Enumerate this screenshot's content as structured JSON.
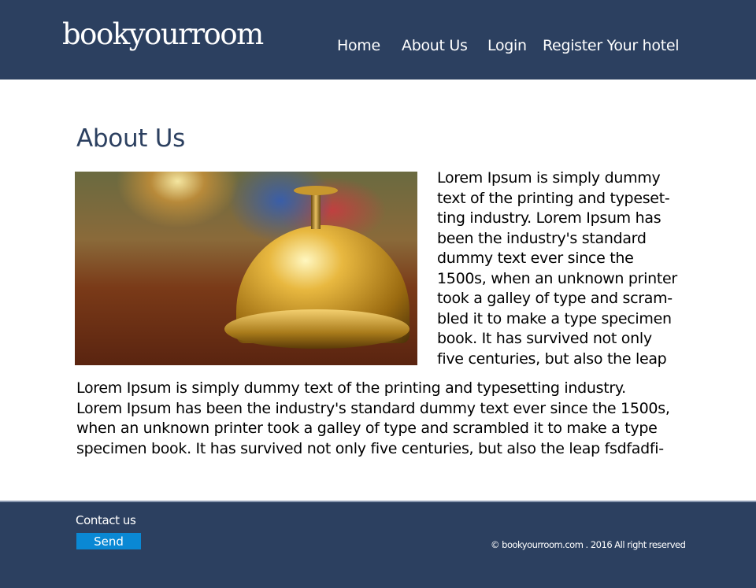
{
  "header": {
    "logo": "bookyourroom",
    "nav": [
      "Home",
      "About Us",
      "Login",
      "Register Your hotel"
    ]
  },
  "main": {
    "title": "About Us",
    "side_text_lines": [
      "Lorem Ipsum is simply dummy",
      "text of the printing and typeset-",
      "ting industry. Lorem Ipsum has",
      "been the industry's standard",
      "dummy text ever since the",
      "1500s, when an unknown printer",
      "took a galley of type and scram-",
      "bled it to make a type specimen",
      "book. It has survived not only",
      "five centuries, but also the leap"
    ],
    "body_text_lines": [
      "Lorem Ipsum is simply dummy text of the printing and typesetting industry.",
      "Lorem Ipsum has been the industry's standard dummy text ever since the 1500s,",
      "when an unknown printer took a galley of type and scrambled it to make a type",
      "specimen book. It has survived not only five centuries, but also the leap fsdfadfi-"
    ]
  },
  "footer": {
    "contact_label": "Contact us",
    "send_label": "Send",
    "copyright": "© bookyourroom.com . 2016 All right reserved"
  },
  "colors": {
    "brand": "#2c4060",
    "button": "#0a88d4"
  }
}
